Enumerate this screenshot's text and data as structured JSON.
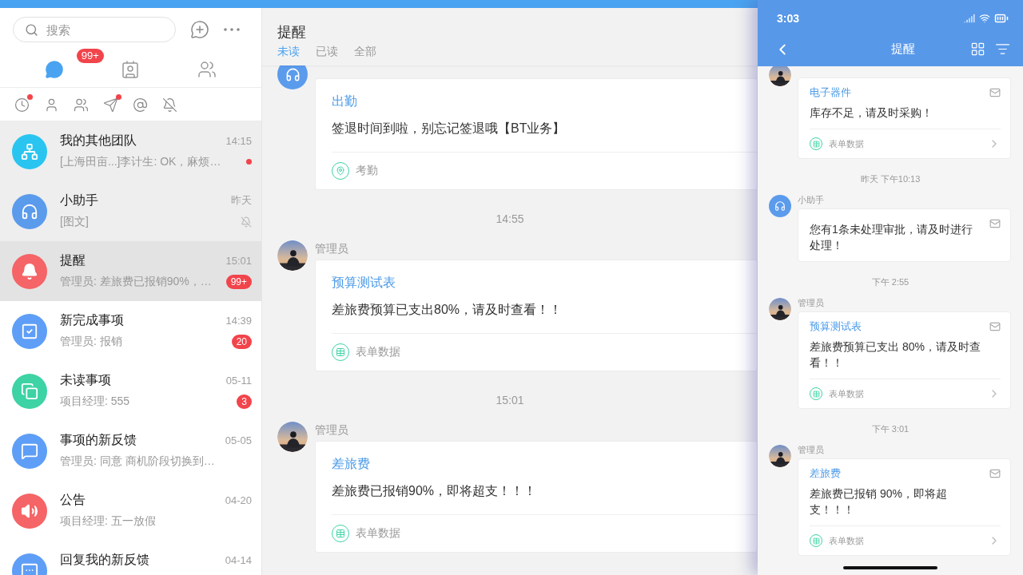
{
  "sidebar": {
    "search": {
      "placeholder": "搜索"
    },
    "tabs": [
      {
        "kind": "chat",
        "selected": true,
        "badge": "99+"
      },
      {
        "kind": "contacts",
        "selected": false
      },
      {
        "kind": "groups",
        "selected": false
      }
    ],
    "filters": [
      {
        "kind": "recent",
        "dot": true
      },
      {
        "kind": "person",
        "dot": false
      },
      {
        "kind": "group",
        "dot": false
      },
      {
        "kind": "sent",
        "dot": true
      },
      {
        "kind": "mention",
        "dot": false
      },
      {
        "kind": "muted",
        "dot": false
      }
    ],
    "conversations": [
      {
        "kind": "team",
        "color": "#29c5f0",
        "title": "我的其他团队",
        "preview": "[上海田亩...]李计生: OK，麻烦…",
        "time": "14:15",
        "pinned": true,
        "selected": false,
        "dot": true
      },
      {
        "kind": "assistant",
        "color": "#5b9bec",
        "title": "小助手",
        "preview": "[图文]",
        "time": "昨天",
        "pinned": true,
        "selected": false,
        "muted": true
      },
      {
        "kind": "reminder",
        "color": "#f56466",
        "title": "提醒",
        "preview": "管理员: 差旅费已报销90%，…",
        "time": "15:01",
        "pinned": false,
        "selected": true,
        "badge": "99+"
      },
      {
        "kind": "done",
        "color": "#5e9ef6",
        "title": "新完成事项",
        "preview": "管理员: 报销",
        "time": "14:39",
        "pinned": false,
        "selected": false,
        "badge": "20"
      },
      {
        "kind": "unread",
        "color": "#3dd3a4",
        "title": "未读事项",
        "preview": "项目经理: 555",
        "time": "05-11",
        "pinned": false,
        "selected": false,
        "badge": "3"
      },
      {
        "kind": "feedback",
        "color": "#5e9ef6",
        "title": "事项的新反馈",
        "preview": "管理员: 同意 商机阶段切换到…",
        "time": "05-05",
        "pinned": false,
        "selected": false
      },
      {
        "kind": "notice",
        "color": "#f56466",
        "title": "公告",
        "preview": "项目经理: 五一放假",
        "time": "04-20",
        "pinned": false,
        "selected": false
      },
      {
        "kind": "reply",
        "color": "#5e9ef6",
        "title": "回复我的新反馈",
        "time": "04-14",
        "pinned": false,
        "selected": false
      }
    ]
  },
  "center": {
    "title": "提醒",
    "tabs": [
      {
        "label": "未读",
        "selected": true
      },
      {
        "label": "已读",
        "selected": false
      },
      {
        "label": "全部",
        "selected": false
      }
    ],
    "feed": [
      {
        "kind": "message",
        "avatar": {
          "kind": "assistant"
        },
        "title": "出勤",
        "body": "签退时间到啦，别忘记签退哦【BT业务】",
        "footer": {
          "kind": "attendance",
          "label": "考勤"
        }
      },
      {
        "kind": "time",
        "label": "14:55"
      },
      {
        "kind": "message",
        "sender": "管理员",
        "title": "预算测试表",
        "body": "差旅费预算已支出80%，请及时查看！！",
        "footer": {
          "kind": "form",
          "label": "表单数据"
        }
      },
      {
        "kind": "time",
        "label": "15:01"
      },
      {
        "kind": "message",
        "sender": "管理员",
        "title": "差旅费",
        "body": "差旅费已报销90%，即将超支！！！",
        "footer": {
          "kind": "form",
          "label": "表单数据"
        }
      }
    ]
  },
  "phone": {
    "status_bar": {
      "time": "3:03"
    },
    "title": "提醒",
    "feed": [
      {
        "kind": "message",
        "title": "电子器件",
        "body": "库存不足，请及时采购！",
        "footer": {
          "kind": "form",
          "label": "表单数据"
        }
      },
      {
        "kind": "time",
        "label": "昨天 下午10:13"
      },
      {
        "kind": "message",
        "avatar": {
          "kind": "assistant"
        },
        "sender": "小助手",
        "body": "您有1条未处理审批，请及时进行处理！"
      },
      {
        "kind": "time",
        "label": "下午 2:55"
      },
      {
        "kind": "message",
        "sender": "管理员",
        "title": "预算测试表",
        "body": "差旅费预算已支出 80%，请及时查看！！",
        "footer": {
          "kind": "form",
          "label": "表单数据"
        }
      },
      {
        "kind": "time",
        "label": "下午 3:01"
      },
      {
        "kind": "message",
        "sender": "管理员",
        "title": "差旅费",
        "body": "差旅费已报销 90%，即将超支！！！",
        "footer": {
          "kind": "form",
          "label": "表单数据"
        }
      }
    ]
  }
}
